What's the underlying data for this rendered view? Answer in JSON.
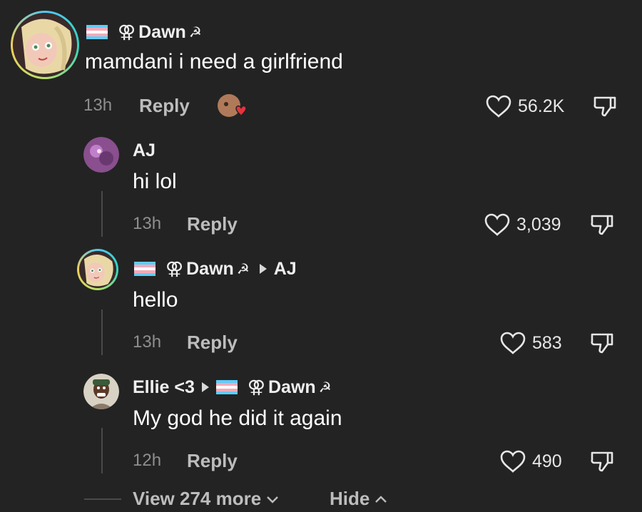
{
  "comment": {
    "user": "Dawn",
    "text": "mamdani i need a girlfriend",
    "time": "13h",
    "reply_label": "Reply",
    "likes": "56.2K"
  },
  "replies": [
    {
      "user": "AJ",
      "text": "hi lol",
      "time": "13h",
      "reply_label": "Reply",
      "likes": "3,039"
    },
    {
      "user": "Dawn",
      "reply_to": "AJ",
      "text": "hello",
      "time": "13h",
      "reply_label": "Reply",
      "likes": "583"
    },
    {
      "user": "Ellie <3",
      "reply_to": "Dawn",
      "text": "My god he did it again",
      "time": "12h",
      "reply_label": "Reply",
      "likes": "490"
    }
  ],
  "footer": {
    "view_more": "View 274 more",
    "hide": "Hide"
  },
  "symbols": {
    "gender": "⚢",
    "hammer_sickle": "☭"
  },
  "colors": {
    "background": "#232323",
    "trans_blue": "#5bcefa",
    "trans_pink": "#f5a9b8",
    "heart_red": "#e8323c"
  }
}
